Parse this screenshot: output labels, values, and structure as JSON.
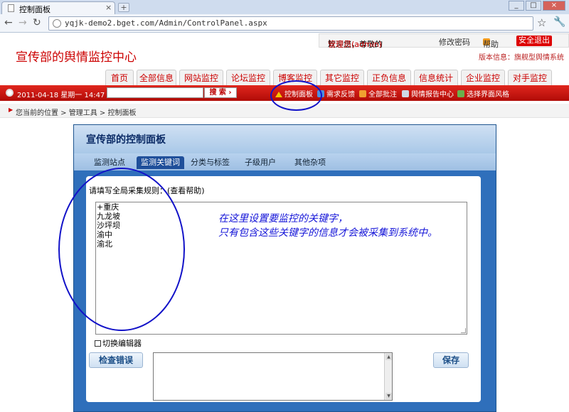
{
  "browser": {
    "tab_title": "控制面板",
    "tab_close": "×",
    "new_tab": "+",
    "win_min": "_",
    "win_max": "□",
    "win_close": "×",
    "back": "←",
    "forward": "→",
    "reload": "↻",
    "url": "yqjk-demo2.bget.com/Admin/ControlPanel.aspx",
    "star": "☆",
    "wrench": "🔧"
  },
  "header": {
    "welcome_prefix": "欢迎您，尊敬的",
    "user": "管理员(admin)",
    "welcome_suffix": "!",
    "change_password": "修改密码",
    "help": "帮助",
    "logout": "安全退出",
    "site_title": "宣传部的舆情监控中心",
    "version": "版本信息：旗舰型舆情系统"
  },
  "main_nav": [
    "首页",
    "全部信息",
    "网站监控",
    "论坛监控",
    "博客监控",
    "其它监控",
    "正负信息",
    "信息统计",
    "企业监控",
    "对手监控"
  ],
  "redbar": {
    "date": "2011-04-18 星期一 14:47",
    "search_placeholder": "",
    "search_button": "搜 索 ›",
    "links": [
      "控制面板",
      "需求反馈",
      "全部批注",
      "舆情报告中心",
      "选择界面风格"
    ],
    "link_icon_colors": [
      "#f5c400",
      "#4a8fe0",
      "#f0a030",
      "#cfd8e6",
      "#6ab04c"
    ]
  },
  "breadcrumb": {
    "arrow": "▶",
    "text": "您当前的位置 > 管理工具 > 控制面板"
  },
  "panel": {
    "title": "宣传部的控制面板",
    "tabs": [
      "监测站点",
      "监测关键词",
      "分类与标签",
      "子级用户",
      "其他杂项"
    ],
    "active_tab": "监测关键词",
    "rules_label": "请填写全局采集规则：",
    "help_link": "(查看帮助)",
    "keywords": [
      "+重庆",
      "九龙坡",
      "沙坪坝",
      "渝中",
      "渝北"
    ],
    "switch_editor": "切换编辑器",
    "check_button": "检查错误",
    "save_button": "保存",
    "scroll_up": "▲",
    "scroll_down": "▼"
  },
  "annotation": {
    "line1": "在这里设置要监控的关键字，",
    "line2": "只有包含这些关键字的信息才会被采集到系统中。",
    "color": "#1414d8"
  }
}
